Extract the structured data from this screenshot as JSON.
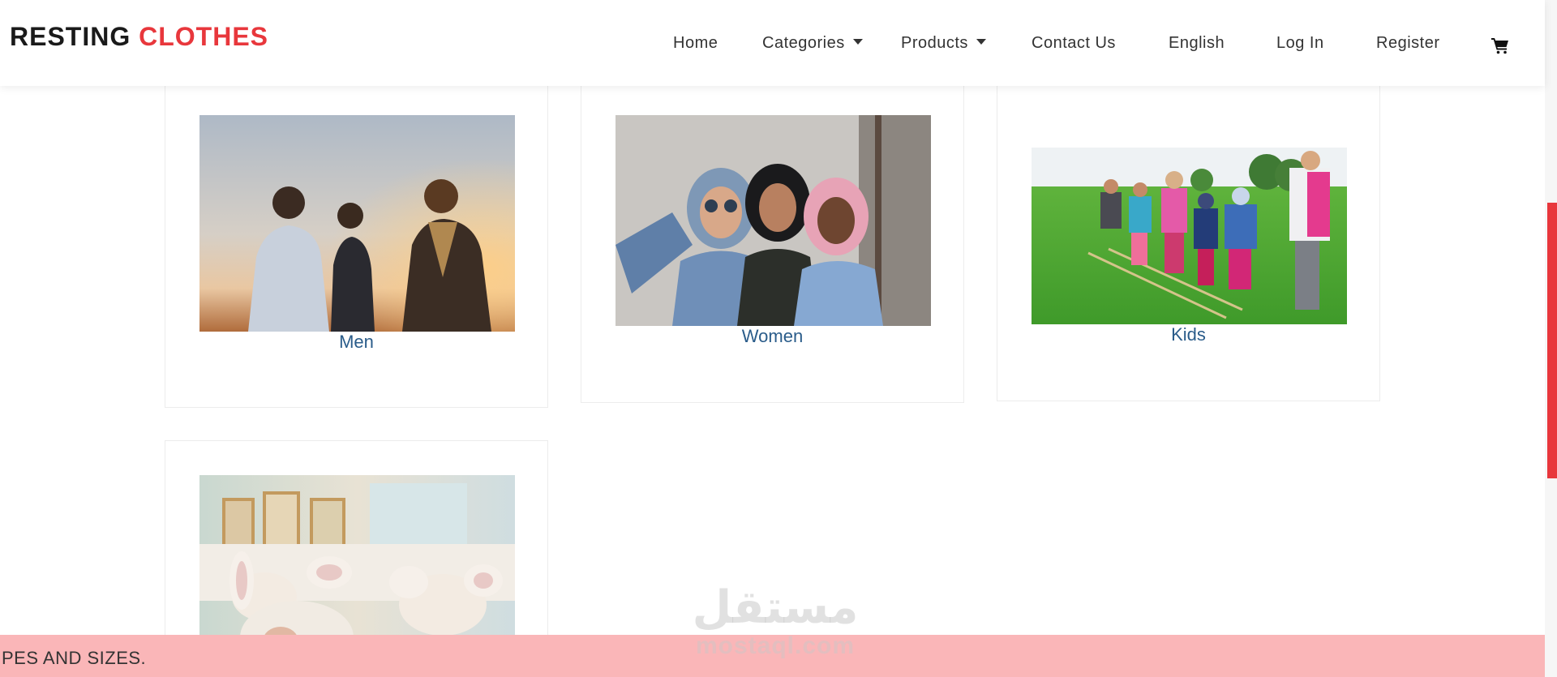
{
  "brand": {
    "name_part1": "RESTING ",
    "name_part2": "CLOTHES",
    "accent_color": "#e8373c"
  },
  "nav": {
    "items": [
      {
        "label": "Home",
        "dropdown": false
      },
      {
        "label": "Categories",
        "dropdown": true
      },
      {
        "label": "Products",
        "dropdown": true
      },
      {
        "label": "Contact Us",
        "dropdown": false
      },
      {
        "label": "English",
        "dropdown": false
      },
      {
        "label": "Log In",
        "dropdown": false
      },
      {
        "label": "Register",
        "dropdown": false
      }
    ],
    "cart_icon": "shopping-cart-icon"
  },
  "categories": [
    {
      "label": "Men",
      "image": "men-photo"
    },
    {
      "label": "Women",
      "image": "women-photo"
    },
    {
      "label": "Kids",
      "image": "kids-photo"
    },
    {
      "label": "",
      "image": "babies-photo"
    }
  ],
  "ticker": {
    "text": "PES AND SIZES."
  },
  "watermark": {
    "latin": "mostaql.com",
    "arabic": "مستقل"
  },
  "colors": {
    "link": "#2a5c8a",
    "ticker_bg": "#fab6b8",
    "scrollbar": "#e8373c"
  }
}
